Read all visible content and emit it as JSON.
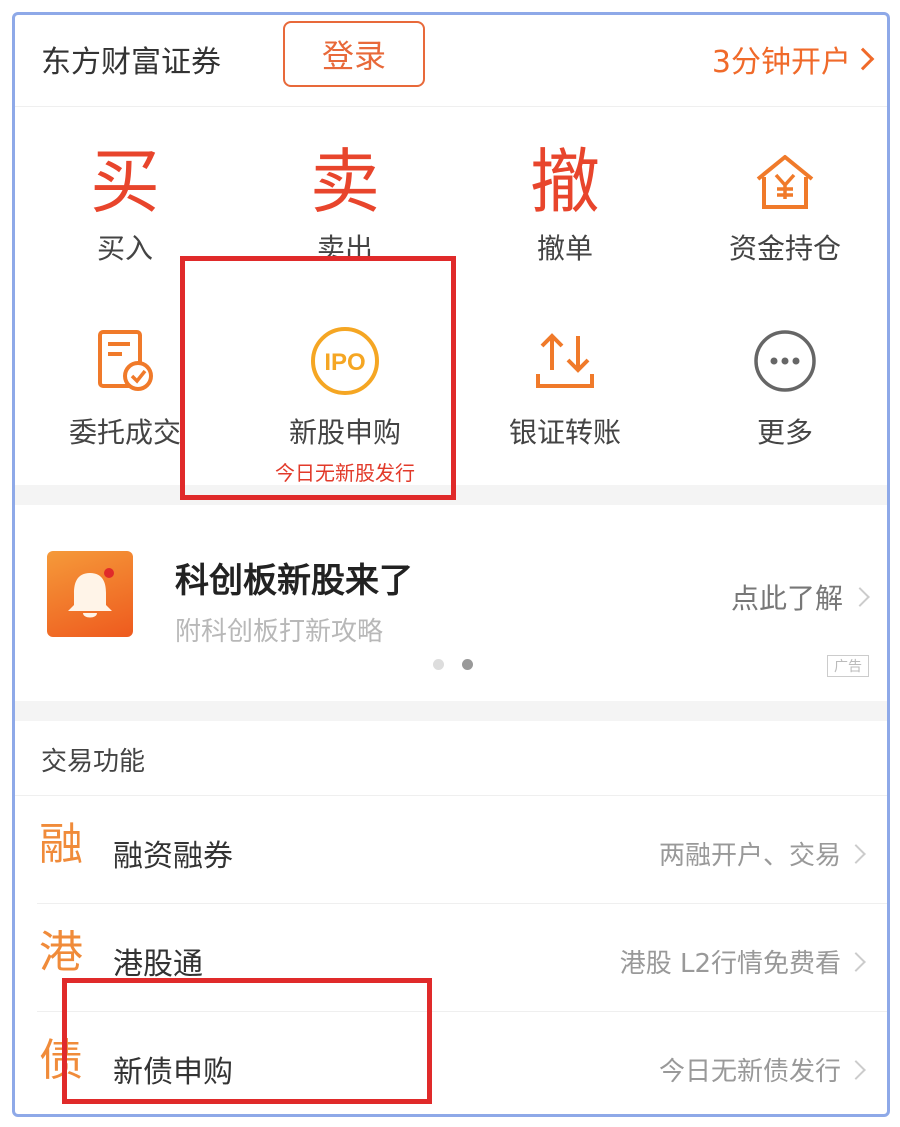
{
  "header": {
    "brand": "东方财富证券",
    "login_label": "登录",
    "open_account_label": "3分钟开户"
  },
  "grid": {
    "items": [
      {
        "glyph": "买",
        "label": "买入"
      },
      {
        "glyph": "卖",
        "label": "卖出"
      },
      {
        "glyph": "撤",
        "label": "撤单"
      },
      {
        "icon": "house-yen-icon",
        "label": "资金持仓"
      },
      {
        "icon": "order-check-icon",
        "label": "委托成交"
      },
      {
        "icon": "ipo-icon",
        "icon_text": "IPO",
        "label": "新股申购",
        "sub": "今日无新股发行"
      },
      {
        "icon": "transfer-arrows-icon",
        "label": "银证转账"
      },
      {
        "icon": "more-dots-icon",
        "label": "更多"
      }
    ]
  },
  "banner": {
    "title": "科创板新股来了",
    "subtitle": "附科创板打新攻略",
    "link": "点此了解",
    "ad_tag": "广告"
  },
  "section": {
    "title": "交易功能",
    "rows": [
      {
        "glyph": "融",
        "label": "融资融券",
        "right": "两融开户、交易"
      },
      {
        "glyph": "港",
        "label": "港股通",
        "right": "港股 L2行情免费看"
      },
      {
        "glyph": "债",
        "label": "新债申购",
        "right": "今日无新债发行"
      }
    ]
  },
  "colors": {
    "accent": "#e8693a",
    "highlight": "#e02a2a",
    "frame": "#8ea9e8",
    "glyph_red": "#e8452c",
    "row_icon_orange": "#f08b3a"
  }
}
